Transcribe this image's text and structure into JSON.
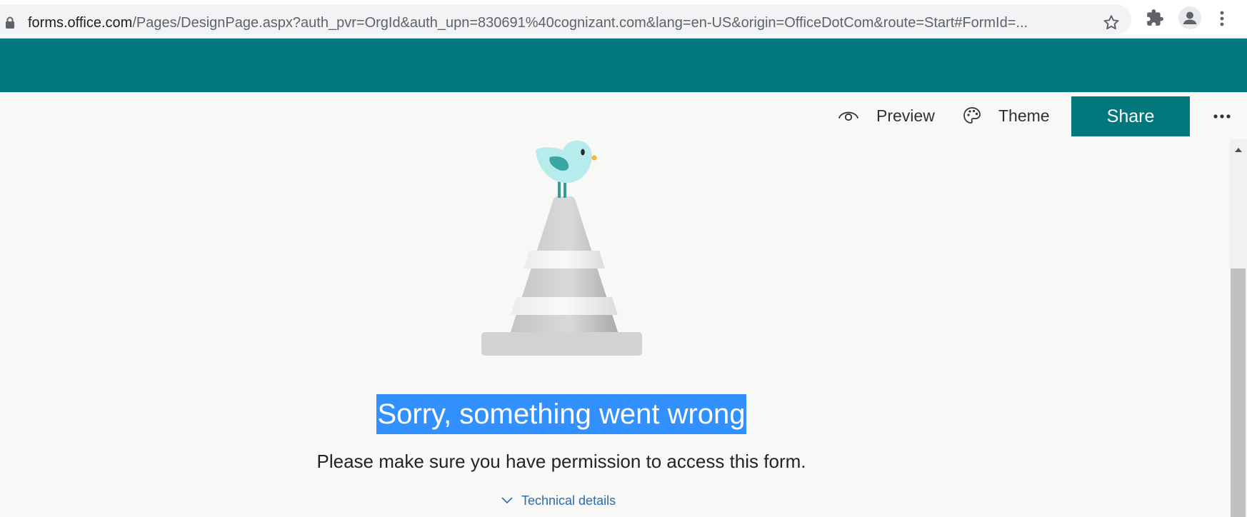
{
  "browser": {
    "url_host": "forms.office.com",
    "url_path": "/Pages/DesignPage.aspx?auth_pvr=OrgId&auth_upn=830691%40cognizant.com&lang=en-US&origin=OfficeDotCom&route=Start#FormId=..."
  },
  "header": {
    "brand_color": "#03787c"
  },
  "command_bar": {
    "preview_label": "Preview",
    "theme_label": "Theme",
    "share_label": "Share"
  },
  "error": {
    "title": "Sorry, something went wrong",
    "description": "Please make sure you have permission to access this form.",
    "details_link": "Technical details",
    "title_highlight_color": "#3390ff"
  },
  "icons": {
    "address_bar": [
      "lock-icon",
      "star-icon",
      "extensions-icon",
      "profile-icon",
      "menu-icon"
    ],
    "command_bar": [
      "eye-icon",
      "palette-icon",
      "more-icon"
    ],
    "content": [
      "chevron-down-icon"
    ]
  }
}
